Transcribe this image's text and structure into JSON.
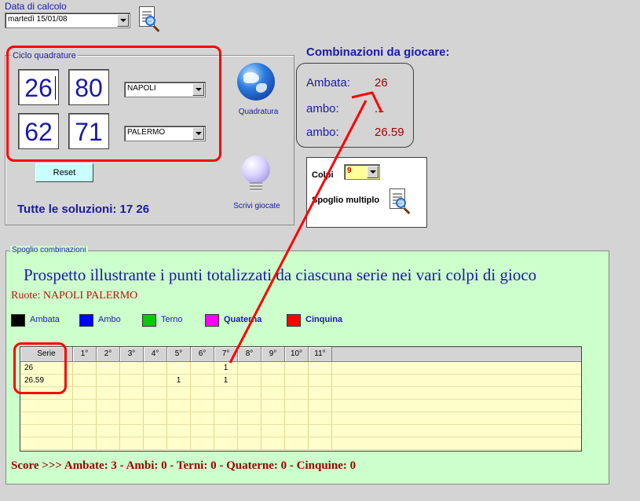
{
  "date": {
    "label": "Data di calcolo",
    "value": "martedì 15/01/08"
  },
  "ciclo": {
    "title": "Ciclo quadrature",
    "numbers": [
      "26",
      "80",
      "62",
      "71"
    ],
    "wheels": [
      "NAPOLI",
      "PALERMO"
    ],
    "quadratura_label": "Quadratura",
    "reset_label": "Reset",
    "scrivi_label": "Scrivi giocate",
    "tutte_label": "Tutte le soluzioni: 17 26"
  },
  "combinazioni": {
    "title": "Combinazioni da giocare:",
    "rows": [
      {
        "label": "Ambata:",
        "value": "26"
      },
      {
        "label": "ambo:",
        "value": "..."
      },
      {
        "label": "ambo:",
        "value": "26.59"
      }
    ]
  },
  "colpi": {
    "label": "Colpi",
    "value": "9",
    "spoglio_label": "Spoglio multiplo"
  },
  "spoglio": {
    "title": "Spoglio combinazioni",
    "heading": "Prospetto illustrante i punti totalizzati da ciascuna serie nei vari colpi di gioco",
    "ruote": "Ruote: NAPOLI PALERMO",
    "legend": [
      {
        "label": "Ambata",
        "color": "#000000"
      },
      {
        "label": "Ambo",
        "color": "#0000ff"
      },
      {
        "label": "Terno",
        "color": "#00cc00"
      },
      {
        "label": "Quaterna",
        "color": "#ff00ff"
      },
      {
        "label": "Cinquina",
        "color": "#ff0000"
      }
    ],
    "columns": [
      "Serie",
      "1°",
      "2°",
      "3°",
      "4°",
      "5°",
      "6°",
      "7°",
      "8°",
      "9°",
      "10°",
      "11°"
    ],
    "rows": [
      [
        "26",
        "",
        "",
        "",
        "",
        "",
        "",
        "1",
        "",
        "",
        "",
        ""
      ],
      [
        "26.59",
        "",
        "",
        "",
        "",
        "1",
        "",
        "1",
        "",
        "",
        "",
        ""
      ]
    ],
    "score": "Score >>> Ambate: 3 - Ambi: 0 - Terni: 0 - Quaterne: 0 - Cinquine: 0"
  },
  "colors": {
    "accent_blue": "#1a1aa8",
    "annotation_red": "#ff0000",
    "panel_green": "#ccffcc",
    "grid_yellow": "#ffffcc"
  }
}
